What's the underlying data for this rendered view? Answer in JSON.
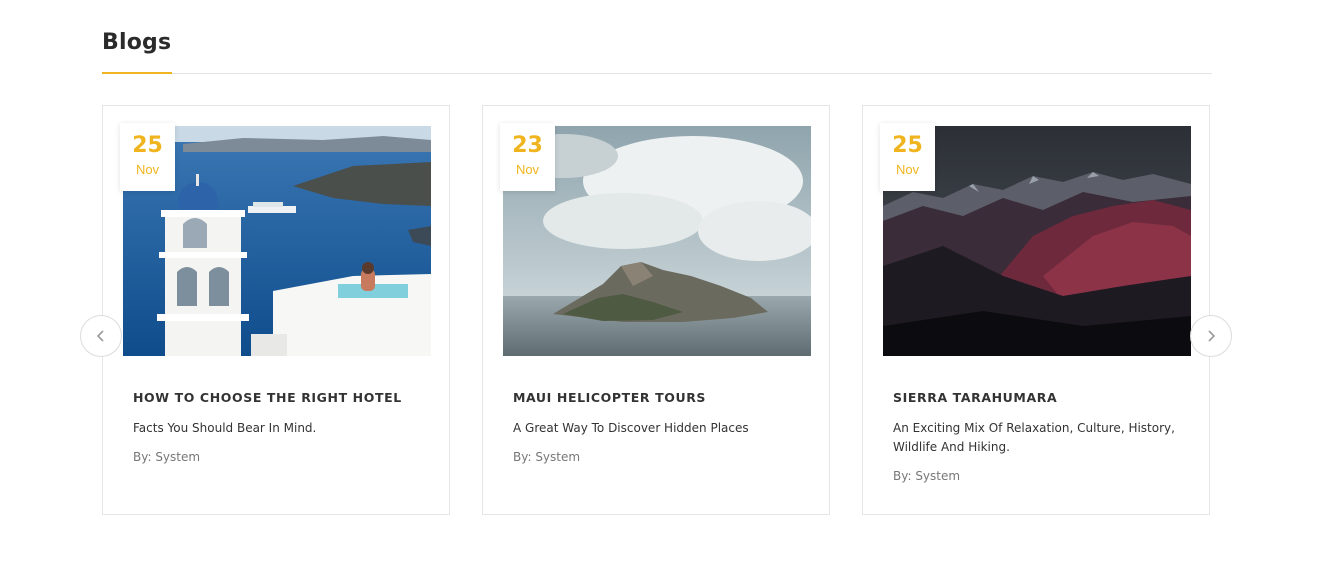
{
  "section": {
    "title": "Blogs"
  },
  "colors": {
    "accent": "#f0b51e",
    "border": "#e6e6e6",
    "text": "#333333",
    "muted": "#777777"
  },
  "carousel": {
    "prev_icon": "chevron-left-icon",
    "next_icon": "chevron-right-icon"
  },
  "posts": [
    {
      "day": "25",
      "month": "Nov",
      "title": "HOW TO CHOOSE THE RIGHT HOTEL",
      "description": "Facts You Should Bear In Mind.",
      "author": "By: System",
      "image": "santorini-hotel-photo"
    },
    {
      "day": "23",
      "month": "Nov",
      "title": "MAUI HELICOPTER TOURS",
      "description": "A Great Way To Discover Hidden Places",
      "author": "By: System",
      "image": "island-sea-photo"
    },
    {
      "day": "25",
      "month": "Nov",
      "title": "SIERRA TARAHUMARA",
      "description": "An Exciting Mix Of Relaxation, Culture, History, Wildlife And Hiking.",
      "author": "By: System",
      "image": "mountain-range-photo"
    }
  ]
}
